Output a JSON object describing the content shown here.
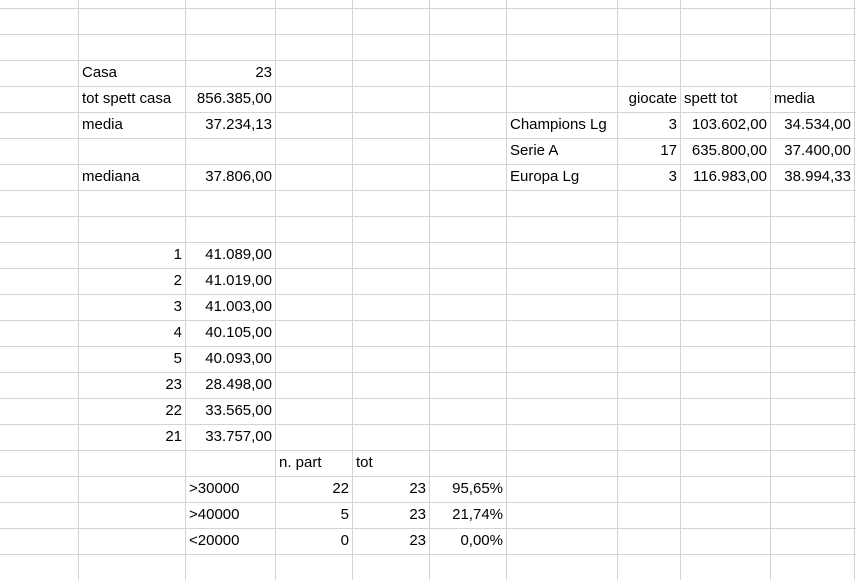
{
  "sheet": {
    "summary": [
      {
        "label": "Casa",
        "value": "23"
      },
      {
        "label": "tot spett casa",
        "value": "856.385,00"
      },
      {
        "label": "media",
        "value": "37.234,13"
      },
      {
        "label": "mediana",
        "value": "37.806,00"
      }
    ],
    "ranking": [
      {
        "rank": "1",
        "value": "41.089,00"
      },
      {
        "rank": "2",
        "value": "41.019,00"
      },
      {
        "rank": "3",
        "value": "41.003,00"
      },
      {
        "rank": "4",
        "value": "40.105,00"
      },
      {
        "rank": "5",
        "value": "40.093,00"
      },
      {
        "rank": "23",
        "value": "28.498,00"
      },
      {
        "rank": "22",
        "value": "33.565,00"
      },
      {
        "rank": "21",
        "value": "33.757,00"
      }
    ],
    "thresholds": {
      "headers": {
        "n_part": "n. part",
        "tot": "tot"
      },
      "rows": [
        {
          "label": ">30000",
          "n_part": "22",
          "tot": "23",
          "pct": "95,65%"
        },
        {
          "label": ">40000",
          "n_part": "5",
          "tot": "23",
          "pct": "21,74%"
        },
        {
          "label": "<20000",
          "n_part": "0",
          "tot": "23",
          "pct": "0,00%"
        }
      ]
    },
    "competitions": {
      "headers": {
        "giocate": "giocate",
        "spett_tot": "spett tot",
        "media": "media"
      },
      "rows": [
        {
          "name": "Champions Lg",
          "giocate": "3",
          "spett_tot": "103.602,00",
          "media": "34.534,00"
        },
        {
          "name": "Serie A",
          "giocate": "17",
          "spett_tot": "635.800,00",
          "media": "37.400,00"
        },
        {
          "name": "Europa Lg",
          "giocate": "3",
          "spett_tot": "116.983,00",
          "media": "38.994,33"
        }
      ]
    }
  }
}
